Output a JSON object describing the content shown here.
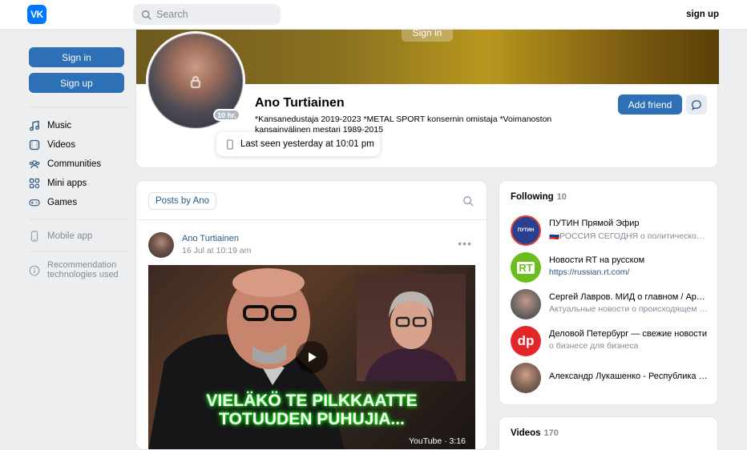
{
  "header": {
    "logo": "VK",
    "search_placeholder": "Search",
    "signup_label": "sign up"
  },
  "sidebar": {
    "sign_in_label": "Sign in",
    "sign_up_label": "Sign up",
    "items": [
      {
        "label": "Music",
        "icon": "music-icon"
      },
      {
        "label": "Videos",
        "icon": "video-icon"
      },
      {
        "label": "Communities",
        "icon": "communities-icon"
      },
      {
        "label": "Mini apps",
        "icon": "mini-apps-icon"
      },
      {
        "label": "Games",
        "icon": "gamepad-icon"
      }
    ],
    "mobile_app_label": "Mobile app",
    "recommendation_label_1": "Recommendation",
    "recommendation_label_2": "technologies used"
  },
  "profile": {
    "cover_signin_label": "Sign in",
    "name": "Ano Turtiainen",
    "status": "*Kansanedustaja 2019-2023 *METAL SPORT konsernin omistaja *Voimanoston kansainvälinen mestari 1989-2015",
    "online_badge": "10 hr.",
    "last_seen": "Last seen yesterday at 10:01 pm",
    "add_friend_label": "Add friend"
  },
  "posts": {
    "tab_label": "Posts by Ano",
    "post": {
      "author": "Ano Turtiainen",
      "date": "16 Jul at 10:19 am",
      "video_title_line1": "VIELÄKÖ TE PILKKAATTE",
      "video_title_line2": "TOTUUDEN PUHUJIA...",
      "video_meta": "YouTube · 3:16"
    }
  },
  "following": {
    "title": "Following",
    "count": "10",
    "items": [
      {
        "title": "ПУТИН Прямой Эфир",
        "subtitle": "🇷🇺РОССИЯ СЕГОДНЯ о политической жизни",
        "avatar_text": "ПУТИН",
        "avatar_color": "#2a3f8f"
      },
      {
        "title": "Новости RT на русском",
        "subtitle": "https://russian.rt.com/",
        "avatar_text": "RT",
        "avatar_color": "#6cbe1e"
      },
      {
        "title": "Сергей Лавров. МИД о главном / Архив",
        "subtitle": "Актуальные новости о происходящем в мире",
        "avatar_text": "",
        "avatar_color": "#5b6270"
      },
      {
        "title": "Деловой Петербург — свежие новости",
        "subtitle": "о бизнесе для бизнеса",
        "avatar_text": "dp",
        "avatar_color": "#e3262a"
      },
      {
        "title": "Александр Лукашенко - Республика Беларусь",
        "subtitle": "",
        "avatar_text": "",
        "avatar_color": "#7a6a5a"
      }
    ]
  },
  "videos": {
    "title": "Videos",
    "count": "170"
  }
}
